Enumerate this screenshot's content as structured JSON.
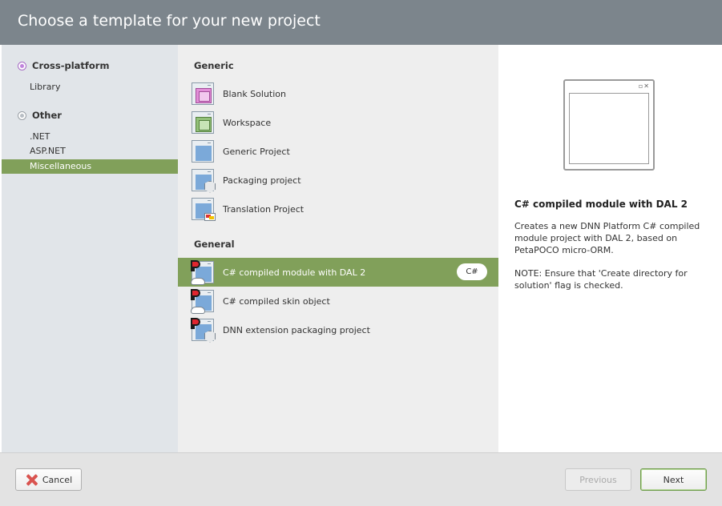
{
  "dialog": {
    "title": "Choose a template for your new project"
  },
  "sidebar": {
    "categories": [
      {
        "label": "Cross-platform",
        "items": [
          "Library"
        ]
      },
      {
        "label": "Other",
        "items": [
          ".NET",
          "ASP.NET",
          "Miscellaneous"
        ]
      }
    ],
    "selected": "Miscellaneous"
  },
  "templates": {
    "groups": [
      {
        "label": "Generic",
        "items": [
          {
            "label": "Blank Solution",
            "icon": "blank-solution-icon"
          },
          {
            "label": "Workspace",
            "icon": "workspace-icon"
          },
          {
            "label": "Generic Project",
            "icon": "generic-project-icon"
          },
          {
            "label": "Packaging project",
            "icon": "packaging-project-icon"
          },
          {
            "label": "Translation Project",
            "icon": "translation-project-icon"
          }
        ]
      },
      {
        "label": "General",
        "items": [
          {
            "label": "C# compiled module with DAL 2",
            "icon": "dnn-module-icon",
            "language": "C#"
          },
          {
            "label": "C# compiled skin object",
            "icon": "dnn-skin-icon"
          },
          {
            "label": "DNN extension packaging project",
            "icon": "dnn-packaging-icon"
          }
        ]
      }
    ],
    "selected": "C# compiled module with DAL 2"
  },
  "details": {
    "title": "C# compiled module with DAL 2",
    "description": "Creates a new DNN Platform C# compiled module project with DAL 2, based on PetaPOCO micro-ORM.",
    "note": "NOTE: Ensure that 'Create directory for solution' flag is checked.",
    "preview_buttons": "▫✕"
  },
  "footer": {
    "cancel_label": "Cancel",
    "previous_label": "Previous",
    "next_label": "Next"
  },
  "colors": {
    "header_bg": "#7c858c",
    "selection": "#81a05a"
  }
}
